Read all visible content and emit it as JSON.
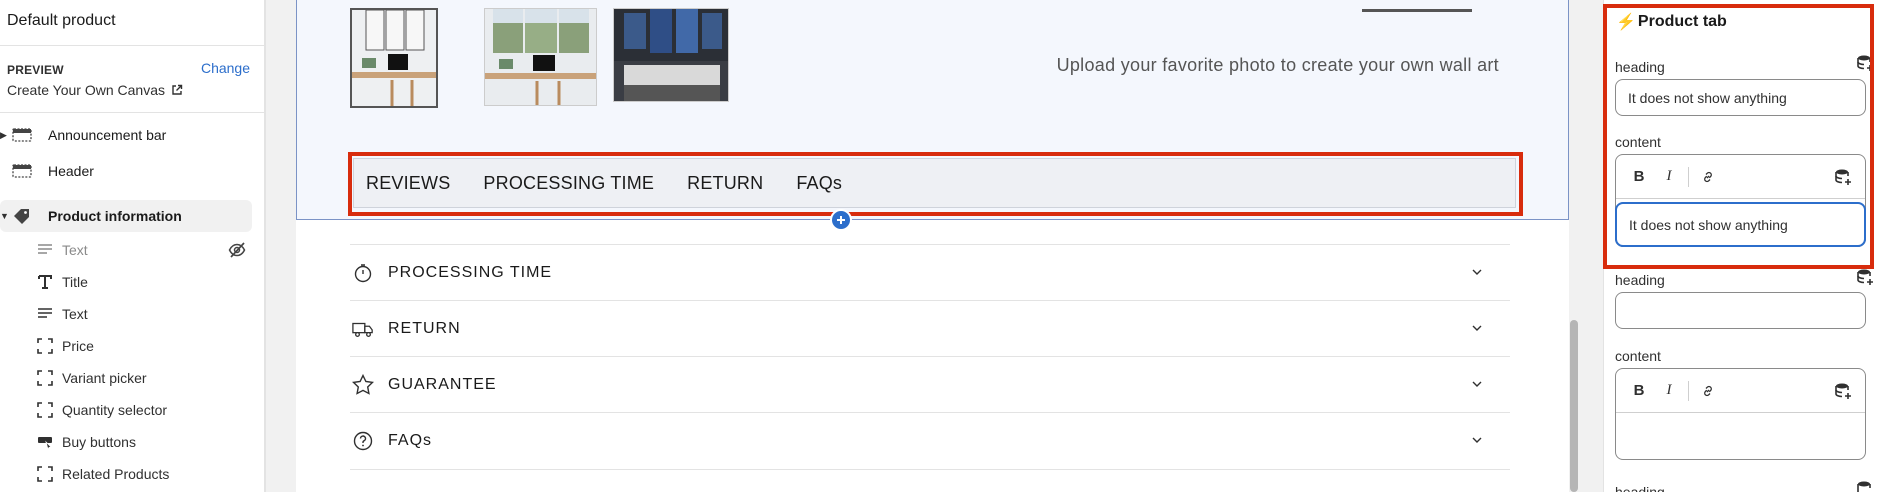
{
  "sidebar": {
    "title": "Default product",
    "preview_label": "PREVIEW",
    "change_label": "Change",
    "preview_value": "Create Your Own Canvas",
    "sections": [
      {
        "label": "Announcement bar"
      },
      {
        "label": "Header"
      },
      {
        "label": "Product information"
      }
    ],
    "blocks": [
      {
        "label": "Text",
        "icon": "text-icon",
        "hidden": true
      },
      {
        "label": "Title",
        "icon": "title-icon"
      },
      {
        "label": "Text",
        "icon": "text-icon"
      },
      {
        "label": "Price",
        "icon": "dashed-square-icon"
      },
      {
        "label": "Variant picker",
        "icon": "dashed-square-icon"
      },
      {
        "label": "Quantity selector",
        "icon": "dashed-square-icon"
      },
      {
        "label": "Buy buttons",
        "icon": "buy-buttons-icon"
      },
      {
        "label": "Related Products",
        "icon": "dashed-square-icon"
      }
    ]
  },
  "canvas": {
    "upload_text": "Upload your favorite photo to create your own wall art",
    "tabs": [
      "REVIEWS",
      "PROCESSING TIME",
      "RETURN",
      "FAQs"
    ],
    "accordion": [
      {
        "label": "PROCESSING TIME",
        "icon": "stopwatch-icon"
      },
      {
        "label": "RETURN",
        "icon": "truck-icon"
      },
      {
        "label": "GUARANTEE",
        "icon": "star-icon"
      },
      {
        "label": "FAQs",
        "icon": "question-icon"
      }
    ]
  },
  "panel": {
    "title": "Product tab",
    "fields": [
      {
        "heading_label": "heading",
        "heading_value": "It does not show anything",
        "content_label": "content",
        "content_value": "It does not show anything"
      },
      {
        "heading_label": "heading",
        "heading_value": "",
        "content_label": "content",
        "content_value": ""
      },
      {
        "heading_label": "heading"
      }
    ],
    "rte_buttons": [
      "B",
      "I"
    ]
  },
  "colors": {
    "highlight": "#d82c0d",
    "accent": "#2c6ecb",
    "bolt": "#f0b400"
  }
}
